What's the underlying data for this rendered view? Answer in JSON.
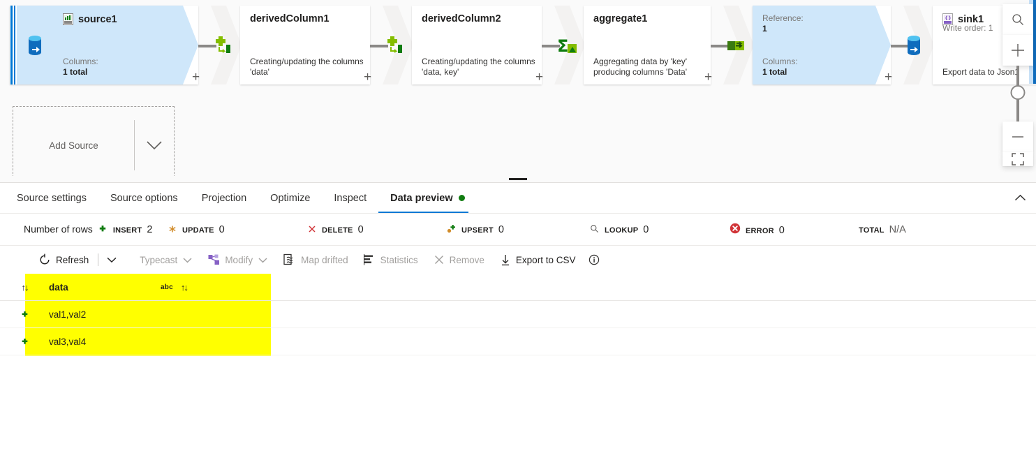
{
  "canvas": {
    "nodes": [
      {
        "id": "source1",
        "name": "source1",
        "kind": "source",
        "selected": true,
        "icon": "csv-file-icon",
        "gutter_icon": "database-source-icon",
        "sub_label": "Columns:",
        "sub_value": "1 total",
        "plus": "+"
      },
      {
        "id": "derivedColumn1",
        "name": "derivedColumn1",
        "kind": "derived",
        "selected": false,
        "desc_line1": "Creating/updating the columns",
        "desc_line2": "'data'",
        "plus": "+"
      },
      {
        "id": "derivedColumn2",
        "name": "derivedColumn2",
        "kind": "derived",
        "selected": false,
        "desc_line1": "Creating/updating the columns",
        "desc_line2": "'data, key'",
        "plus": "+"
      },
      {
        "id": "aggregate1",
        "name": "aggregate1",
        "kind": "aggregate",
        "selected": false,
        "desc_line1": "Aggregating data by 'key'",
        "desc_line2": "producing columns 'Data'",
        "plus": "+"
      },
      {
        "id": "reference1",
        "name": "",
        "kind": "reference",
        "selected": false,
        "ref_label": "Reference:",
        "ref_value": "1",
        "sub_label": "Columns:",
        "sub_value": "1 total",
        "plus": "+"
      },
      {
        "id": "sink1",
        "name": "sink1",
        "kind": "sink",
        "selected": false,
        "icon": "json-file-icon",
        "gutter_icon": "database-sink-icon",
        "write_order": "Write order: 1",
        "desc_line1": "Export data to Json1"
      }
    ],
    "connectors": [
      {
        "icon": "derived-column-icon"
      },
      {
        "icon": "derived-column-icon"
      },
      {
        "icon": "aggregate-sigma-icon"
      },
      {
        "icon": "new-branch-icon"
      },
      {
        "icon": "database-sink-icon"
      }
    ],
    "add_source": {
      "label": "Add Source",
      "chevron": "chevron-down-icon"
    },
    "zoom_controls": {
      "search": "search-icon",
      "zoom_in": "+",
      "zoom_out": "—",
      "fit": "fit-to-screen-icon"
    }
  },
  "tabs": {
    "items": [
      {
        "label": "Source settings",
        "active": false,
        "dot": false
      },
      {
        "label": "Source options",
        "active": false,
        "dot": false
      },
      {
        "label": "Projection",
        "active": false,
        "dot": false
      },
      {
        "label": "Optimize",
        "active": false,
        "dot": false
      },
      {
        "label": "Inspect",
        "active": false,
        "dot": false
      },
      {
        "label": "Data preview",
        "active": true,
        "dot": true
      }
    ],
    "collapse_icon": "chevron-up-icon",
    "dot_color": "#107c10",
    "accent_color": "#0078d4"
  },
  "stats": {
    "lead_label": "Number of rows",
    "items": [
      {
        "name": "INSERT",
        "value": "2",
        "icon": "plus-icon",
        "color": "#107c10"
      },
      {
        "name": "UPDATE",
        "value": "0",
        "icon": "asterisk-icon",
        "color": "#d18b28"
      },
      {
        "name": "DELETE",
        "value": "0",
        "icon": "x-icon",
        "color": "#d13438"
      },
      {
        "name": "UPSERT",
        "value": "0",
        "icon": "upsert-plus-icon",
        "color": "#107c10"
      },
      {
        "name": "LOOKUP",
        "value": "0",
        "icon": "magnifier-icon",
        "color": "#605e5c"
      },
      {
        "name": "ERROR",
        "value": "0",
        "icon": "error-circle-icon",
        "color": "#d13438"
      },
      {
        "name": "TOTAL",
        "value": "N/A",
        "icon": "none",
        "color": "#605e5c"
      }
    ]
  },
  "toolbar": {
    "refresh": {
      "label": "Refresh",
      "icon": "refresh-icon",
      "disabled": false
    },
    "refresh_caret": "chevron-down-icon",
    "typecast": {
      "label": "Typecast",
      "icon": "none",
      "disabled": true
    },
    "modify": {
      "label": "Modify",
      "icon": "modify-icon",
      "disabled": true
    },
    "map_drifted": {
      "label": "Map drifted",
      "icon": "map-drifted-icon",
      "disabled": true
    },
    "statistics": {
      "label": "Statistics",
      "icon": "statistics-icon",
      "disabled": true
    },
    "remove": {
      "label": "Remove",
      "icon": "close-icon",
      "disabled": true
    },
    "export_csv": {
      "label": "Export to CSV",
      "icon": "download-icon",
      "disabled": false
    },
    "info": {
      "label": "",
      "icon": "info-icon",
      "disabled": false
    }
  },
  "grid": {
    "highlight_color": "#ffff00",
    "columns": [
      {
        "label": "data",
        "type": "abc",
        "sort_icon": "sort-updown-icon"
      }
    ],
    "row_marker_header": "sort-updown-icon",
    "rows": [
      {
        "marker": "+",
        "data": "val1,val2"
      },
      {
        "marker": "+",
        "data": "val3,val4"
      }
    ]
  }
}
